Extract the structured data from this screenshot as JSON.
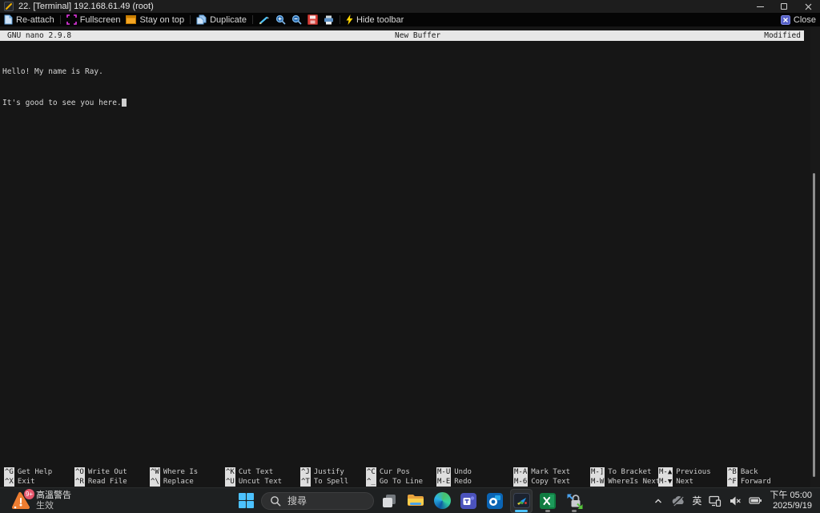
{
  "window": {
    "title": "22. [Terminal] 192.168.61.49 (root)"
  },
  "toolbar": {
    "buttons": {
      "reattach": "Re-attach",
      "fullscreen": "Fullscreen",
      "stay_on_top": "Stay on top",
      "duplicate": "Duplicate",
      "hide_toolbar": "Hide toolbar",
      "close": "Close"
    }
  },
  "nano": {
    "header": {
      "title": "GNU nano 2.9.8",
      "center": "New Buffer",
      "right": "Modified"
    },
    "lines": [
      "Hello! My name is Ray.",
      "It's good to see you here."
    ],
    "shortcuts": [
      [
        {
          "key": "^G",
          "label": "Get Help"
        },
        {
          "key": "^X",
          "label": "Exit"
        }
      ],
      [
        {
          "key": "^O",
          "label": "Write Out"
        },
        {
          "key": "^R",
          "label": "Read File"
        }
      ],
      [
        {
          "key": "^W",
          "label": "Where Is"
        },
        {
          "key": "^\\",
          "label": "Replace"
        }
      ],
      [
        {
          "key": "^K",
          "label": "Cut Text"
        },
        {
          "key": "^U",
          "label": "Uncut Text"
        }
      ],
      [
        {
          "key": "^J",
          "label": "Justify"
        },
        {
          "key": "^T",
          "label": "To Spell"
        }
      ],
      [
        {
          "key": "^C",
          "label": "Cur Pos"
        },
        {
          "key": "^_",
          "label": "Go To Line"
        }
      ],
      [
        {
          "key": "M-U",
          "label": "Undo"
        },
        {
          "key": "M-E",
          "label": "Redo"
        }
      ],
      [
        {
          "key": "M-A",
          "label": "Mark Text"
        },
        {
          "key": "M-6",
          "label": "Copy Text"
        }
      ],
      [
        {
          "key": "M-]",
          "label": "To Bracket"
        },
        {
          "key": "M-W",
          "label": "WhereIs Next"
        }
      ],
      [
        {
          "key": "M-▲",
          "label": "Previous"
        },
        {
          "key": "M-▼",
          "label": "Next"
        }
      ],
      [
        {
          "key": "^B",
          "label": "Back"
        },
        {
          "key": "^F",
          "label": "Forward"
        }
      ]
    ]
  },
  "taskbar": {
    "weather": {
      "badge": "9+",
      "line1": "高溫警告",
      "line2": "生效"
    },
    "search": {
      "placeholder": "搜尋"
    },
    "tray": {
      "ime": "英",
      "time": "下午 05:00",
      "date": "2025/9/19"
    }
  },
  "colors": {
    "accent_blue": "#4cc2ff",
    "nano_bar": "#e7e7e7",
    "terminal_bg": "#161616",
    "taskbar_bg": "#1e2021"
  }
}
